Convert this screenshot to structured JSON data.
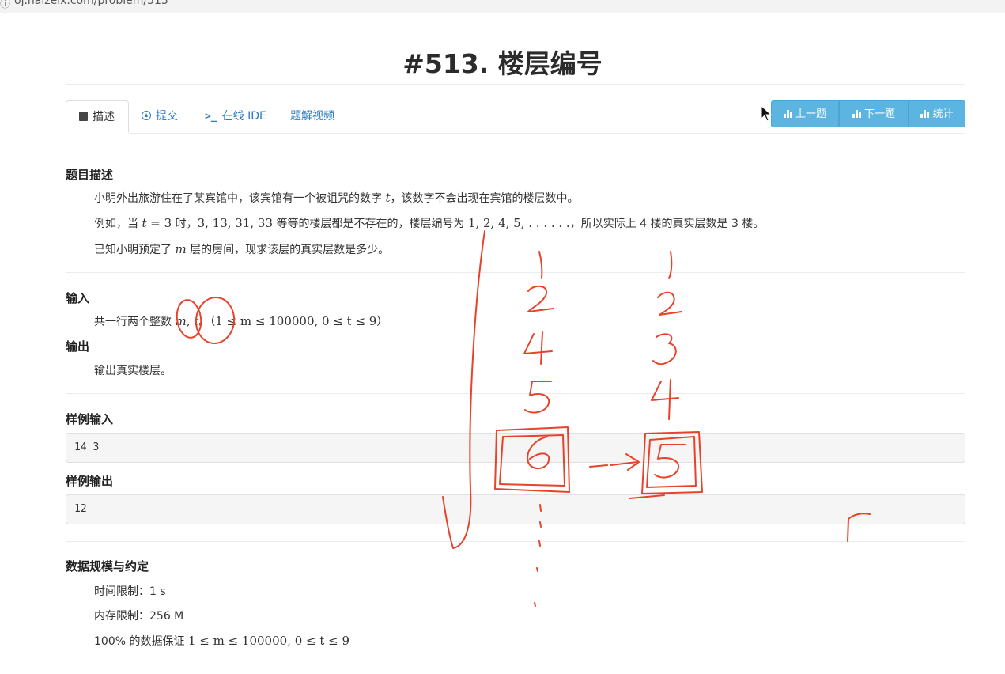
{
  "browser": {
    "info_icon": "info-icon",
    "url": "oj.haizeix.com/problem/513"
  },
  "problem": {
    "title": "#513. 楼层编号"
  },
  "tabs": [
    {
      "label": "描述",
      "icon": "book-icon"
    },
    {
      "label": "提交",
      "icon": "upload-icon"
    },
    {
      "label": "在线 IDE",
      "icon": "terminal-icon"
    },
    {
      "label": "题解视频",
      "icon": ""
    }
  ],
  "nav_buttons": [
    {
      "label": "上一题",
      "icon": "bar-chart-icon"
    },
    {
      "label": "下一题",
      "icon": "bar-chart-icon"
    },
    {
      "label": "统计",
      "icon": "bar-chart-icon"
    }
  ],
  "description": {
    "heading": "题目描述",
    "p1_a": "小明外出旅游住在了某宾馆中，该宾馆有一个被诅咒的数字 ",
    "p1_t": "t",
    "p1_b": "，该数字不会出现在宾馆的楼层数中。",
    "p2_a": "例如，当 ",
    "p2_t": "t",
    "p2_eq": " = 3",
    "p2_b": " 时，",
    "p2_nums": "3, 13, 31, 33",
    "p2_c": " 等等的楼层都是不存在的，楼层编号为 ",
    "p2_seq": "1, 2, 4, 5, . . . . . .",
    "p2_d": "，所以实际上 4 楼的真实层数是 3 楼。",
    "p3_a": "已知小明预定了 ",
    "p3_m": "m",
    "p3_b": " 层的房间，现求该层的真实层数是多少。"
  },
  "input": {
    "heading": "输入",
    "text_a": "共一行两个整数 ",
    "text_vars": "m, t",
    "text_b": "。（",
    "text_range": "1 ≤ m ≤ 100000, 0 ≤ t ≤ 9",
    "text_c": "）"
  },
  "output": {
    "heading": "输出",
    "text": "输出真实楼层。"
  },
  "sample_input": {
    "heading": "样例输入",
    "value": "14 3"
  },
  "sample_output": {
    "heading": "样例输出",
    "value": "12"
  },
  "limits": {
    "heading": "数据规模与约定",
    "time": "时间限制：1 s",
    "memory": "内存限制：256 M",
    "guarantee_a": "100% 的数据保证 ",
    "guarantee_b": "1 ≤ m ≤ 100000, 0 ≤ t ≤ 9"
  },
  "annotations": {
    "color": "#e8432a",
    "left_column": [
      "1",
      "2",
      "4",
      "5",
      "6"
    ],
    "right_column": [
      "1",
      "2",
      "3",
      "4",
      "5"
    ],
    "arrow": "-->",
    "stray": "r"
  },
  "colors": {
    "link": "#2b7bbf",
    "button": "#5bb5e0",
    "ink": "#e8432a"
  }
}
